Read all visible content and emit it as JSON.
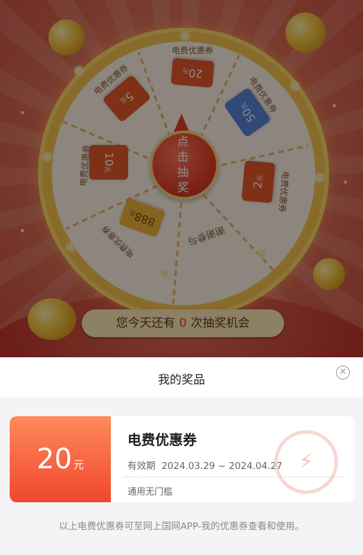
{
  "wheel": {
    "center_button": "点击抽奖",
    "chances_prefix": "您今天还有",
    "chances_count": "0",
    "chances_suffix": "次抽奖机会",
    "slices": [
      {
        "label": "电费优惠券",
        "amount": "20",
        "unit": "元"
      },
      {
        "label": "电费优惠券",
        "amount": "50",
        "unit": "元"
      },
      {
        "label": "电费优惠券",
        "amount": "2",
        "unit": "元"
      },
      {
        "label": "谢谢参与"
      },
      {
        "label": "电费优惠券",
        "amount": "888",
        "unit": "元"
      },
      {
        "label": "电费优惠券",
        "amount": "10",
        "unit": "元"
      },
      {
        "label": "电费优惠券",
        "amount": "5",
        "unit": "元"
      }
    ]
  },
  "sheet": {
    "title": "我的奖品",
    "close_icon": "close-icon",
    "coupon": {
      "amount": "20",
      "unit": "元",
      "name": "电费优惠券",
      "validity_label": "有效期",
      "validity_range": "2024.03.29 ~ 2024.04.27",
      "condition": "通用无门槛"
    },
    "footer_note": "以上电费优惠券可至网上国网APP-我的优惠券查看和使用。"
  },
  "colors": {
    "accent": "#f0472d",
    "coupon_gradient_top": "#ff8a5a",
    "wheel_gold": "#f6c24a"
  }
}
